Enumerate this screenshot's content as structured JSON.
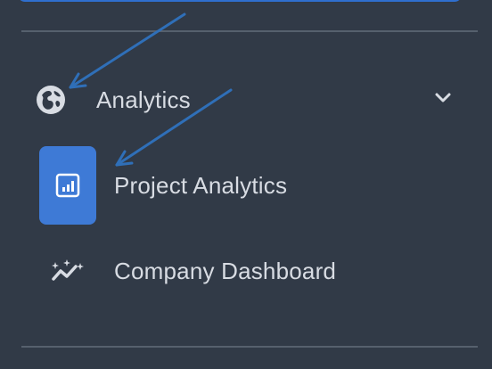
{
  "colors": {
    "background": "#313a47",
    "divider": "#56606d",
    "text": "#d8dce3",
    "active": "#3e7ad6",
    "topButton": "#2f6fcf",
    "annotation": "#2f6fb8"
  },
  "sidebar": {
    "section": {
      "label": "Analytics",
      "icon": "globe-icon",
      "toggle_icon": "chevron-down-icon"
    },
    "items": [
      {
        "label": "Project Analytics",
        "icon": "report-icon",
        "active": true
      },
      {
        "label": "Company Dashboard",
        "icon": "sparkle-chart-icon",
        "active": false
      }
    ]
  },
  "annotations": [
    "globe-icon",
    "project-analytics-icon"
  ]
}
